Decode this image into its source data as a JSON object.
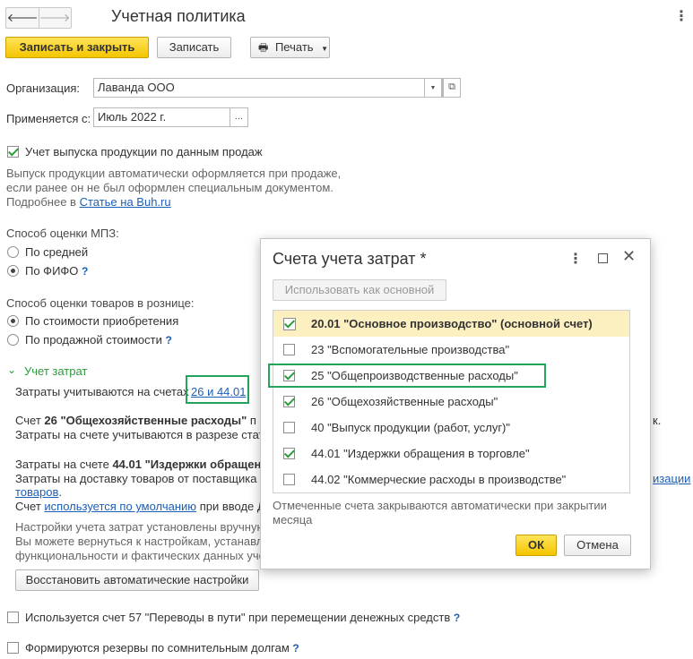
{
  "window": {
    "title": "Учетная политика",
    "back_icon": "arrow-left-icon",
    "forward_icon": "arrow-right-icon",
    "more_icon": "kebab-menu-icon"
  },
  "toolbar": {
    "save_close_label": "Записать и закрыть",
    "save_label": "Записать",
    "print_label": "Печать"
  },
  "form": {
    "org_label": "Организация:",
    "org_value": "Лаванда ООО",
    "applies_label": "Применяется с:",
    "applies_value": "Июль 2022 г.",
    "browse_label": "...",
    "sales_checkbox_label": "Учет выпуска продукции по данным продаж",
    "sales_desc_1": "Выпуск продукции автоматически оформляется при продаже,",
    "sales_desc_2": "если ранее он не был оформлен специальным документом.",
    "sales_desc_3": "Подробнее в",
    "sales_desc_link": "Статье на Buh.ru",
    "mpz_title": "Способ оценки МПЗ:",
    "mpz_avg": "По средней",
    "mpz_fifo": "По ФИФО",
    "retail_title": "Способ оценки товаров в рознице:",
    "retail_cost": "По стоимости приобретения",
    "retail_sale": "По продажной стоимости",
    "help_mark": "?"
  },
  "costs": {
    "section_title": "Учет затрат",
    "accounts_label": "Затраты учитываются на счетах",
    "accounts_link": "26 и 44.01",
    "acc26_prefix": "Счет",
    "acc26_bold": "26 \"Общехозяйственные расходы\"",
    "acc26_tail": "п",
    "acc26_end": "к.",
    "acc26_line2": "Затраты на счете учитываются в разрезе стат",
    "acc44_prefix": "Затраты на счете",
    "acc44_bold": "44.01 \"Издержки обращен",
    "acc44_line2": "Затраты на доставку товаров от поставщика и",
    "acc44_line2_link": "изации",
    "acc44_line3_link": "товаров",
    "acc44_line3_tail": ".",
    "acc44_line4_prefix": "Счет",
    "acc44_line4_link": "используется по умолчанию",
    "acc44_line4_tail": "при вводе Д",
    "manual_1": "Настройки учета затрат установлены вручную",
    "manual_2": "Вы можете вернуться к настройкам, устанавл",
    "manual_3": "функциональности и фактических данных уче",
    "restore_button": "Восстановить автоматические настройки"
  },
  "bottom": {
    "acc57_label": "Используется счет 57 \"Переводы в пути\" при перемещении денежных средств",
    "reserve_label": "Формируются резервы по сомнительным долгам"
  },
  "dialog": {
    "title": "Счета учета затрат *",
    "use_main_button": "Использовать как основной",
    "accounts": [
      {
        "label": "20.01 \"Основное производство\" (основной счет)",
        "checked": true,
        "bold": true,
        "selected": true
      },
      {
        "label": "23 \"Вспомогательные производства\"",
        "checked": false
      },
      {
        "label": "25 \"Общепроизводственные расходы\"",
        "checked": true
      },
      {
        "label": "26 \"Общехозяйственные расходы\"",
        "checked": true
      },
      {
        "label": "40 \"Выпуск продукции (работ, услуг)\"",
        "checked": false
      },
      {
        "label": "44.01 \"Издержки обращения в торговле\"",
        "checked": true
      },
      {
        "label": "44.02 \"Коммерческие расходы в производстве\"",
        "checked": false
      }
    ],
    "footnote_1": "Отмеченные счета закрываются автоматически при закрытии",
    "footnote_2": "месяца",
    "ok_button": "ОК",
    "cancel_button": "Отмена"
  },
  "colors": {
    "accent_yellow": "#f4c500",
    "link_blue": "#1c5fb6",
    "highlight_green": "#22a55a",
    "selected_row": "#fcefc0"
  }
}
